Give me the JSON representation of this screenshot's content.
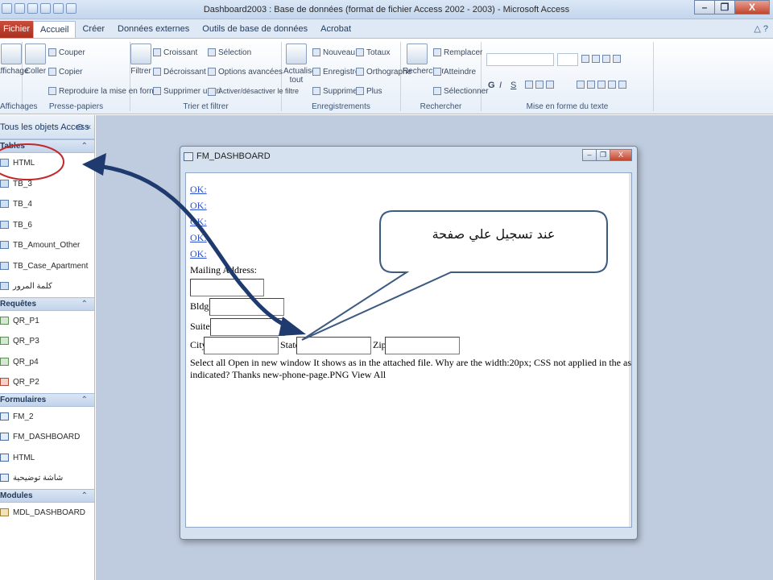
{
  "window": {
    "title": "Dashboard2003 : Base de données (format de fichier Access 2002 - 2003) - Microsoft Access",
    "minimize": "–",
    "restore": "❐",
    "close": "X"
  },
  "ribbon": {
    "tabs": [
      "Fichier",
      "Accueil",
      "Créer",
      "Données externes",
      "Outils de base de données",
      "Acrobat"
    ],
    "active_tab": "Accueil",
    "help": "? ",
    "groups": {
      "affichages": {
        "title": "Affichages",
        "button": "Affichage"
      },
      "presse_papiers": {
        "title": "Presse-papiers",
        "coller": "Coller",
        "couper": "Couper",
        "copier": "Copier",
        "reproduire": "Reproduire la mise en forme"
      },
      "trier": {
        "title": "Trier et filtrer",
        "filtrer": "Filtrer",
        "croissant": "Croissant",
        "decroissant": "Décroissant",
        "supprimer_tri": "Supprimer un tri",
        "selection": "Sélection",
        "options_avancees": "Options avancées",
        "activer_filtre": "Activer/désactiver le filtre"
      },
      "enregistrements": {
        "title": "Enregistrements",
        "actualiser": "Actualiser tout",
        "nouveau": "Nouveau",
        "enregistrer": "Enregistrer",
        "supprimer": "Supprimer",
        "totaux": "Totaux",
        "orthographe": "Orthographe",
        "plus": "Plus"
      },
      "rechercher": {
        "title": "Rechercher",
        "rechercher": "Rechercher",
        "remplacer": "Remplacer",
        "atteindre": "Atteindre",
        "selectionner": "Sélectionner"
      },
      "mise_en_forme": {
        "title": "Mise en forme du texte",
        "gras": "G",
        "italique": "I",
        "souligne": "S"
      }
    }
  },
  "nav": {
    "header": "Tous les objets Access",
    "sections": [
      {
        "title": "Tables",
        "items": [
          "HTML",
          "TB_3",
          "TB_4",
          "TB_6",
          "TB_Amount_Other",
          "TB_Case_Apartment",
          "كلمة المرور"
        ]
      },
      {
        "title": "Requêtes",
        "items": [
          "QR_P1",
          "QR_P3",
          "QR_p4",
          "QR_P2"
        ]
      },
      {
        "title": "Formulaires",
        "items": [
          "FM_2",
          "FM_DASHBOARD",
          "HTML",
          "شاشة توضيحية"
        ]
      },
      {
        "title": "Modules",
        "items": [
          "MDL_DASHBOARD"
        ]
      }
    ]
  },
  "form": {
    "title": "FM_DASHBOARD",
    "links": [
      "OK:",
      "OK:",
      "OK:",
      "OK:",
      "OK:"
    ],
    "mailing_label": "Mailing Address:",
    "bldg_label": "Bldg.#",
    "suite_label": "Suite #",
    "city_label": "City:",
    "state_label": "State:",
    "zip_label": "Zip:",
    "paragraph": "Select all Open in new window It shows as in the attached file. Why are the width:20px; CSS not applied in the as indicated? Thanks new-phone-page.PNG View All"
  },
  "annotation": {
    "callout": "عند تسجيل علي صفحة",
    "colors": {
      "arrow": "#1f3a6e",
      "circle": "#c0282a",
      "callout_border": "#3d5a80"
    }
  }
}
